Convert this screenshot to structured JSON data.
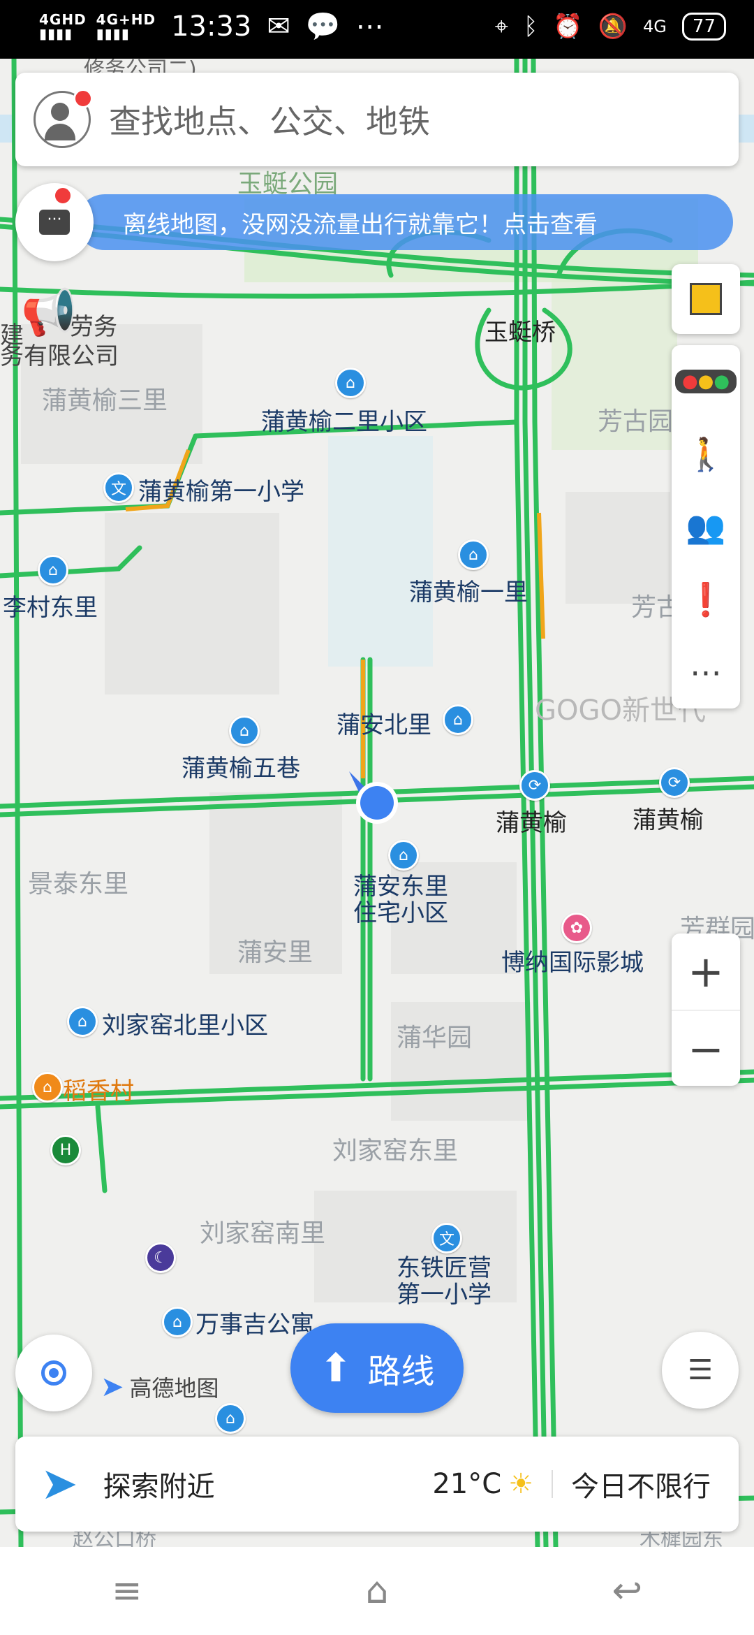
{
  "status_bar": {
    "network1": "4GHD",
    "network2": "4G+HD",
    "time": "13:33",
    "status_icons_left": [
      "mail-icon",
      "chat-icon",
      "more-icon"
    ],
    "status_icons_right": [
      "location-icon",
      "bluetooth-icon",
      "alarm-icon",
      "mute-icon"
    ],
    "net_type": "4G",
    "battery": "77"
  },
  "search": {
    "placeholder": "查找地点、公交、地铁"
  },
  "banner": {
    "text": "离线地图，没网没流量出行就靠它！点击查看"
  },
  "right_toolbar": {
    "items": [
      "layers-icon",
      "traffic-icon",
      "walk-icon",
      "people-icon",
      "feedback-icon",
      "more-icon"
    ]
  },
  "map_labels": {
    "park": "玉蜓公园",
    "bridge": "玉蜓桥",
    "fangguyuan": "芳古园",
    "l1": "蒲黄榆三里",
    "l2": "蒲黄榆二里小区",
    "l3": "蒲黄榆第一小学",
    "l4": "李村东里",
    "l5": "蒲黄榆一里",
    "l6": "芳古",
    "l7": "蒲安北里",
    "l8": "GOGO新世代",
    "l9": "蒲黄榆五巷",
    "l10": "蒲黄榆",
    "l11": "蒲黄榆",
    "l12": "景泰东里",
    "l13": "蒲安东里\n住宅小区",
    "l14": "芳群园",
    "l15": "博纳国际影城",
    "l16": "蒲安里",
    "l17": "刘家窑北里小区",
    "l18": "蒲华园",
    "l19": "稻香村",
    "l20": "刘家窑东里",
    "l21": "刘家窑南里",
    "l22": "东铁匠营\n第一小学",
    "l23": "万事吉公寓",
    "l24": "劳务",
    "l25": "务有限公司",
    "l26": "建",
    "top1": "修务公司二)",
    "bottom1": "赵公口桥",
    "bottom2": "木樨园东"
  },
  "zoom": {
    "plus": "+",
    "minus": "−"
  },
  "route_button": {
    "label": "路线"
  },
  "watermark": "高德地图",
  "bottom_panel": {
    "explore": "探索附近",
    "temperature": "21°C",
    "restriction": "今日不限行"
  }
}
